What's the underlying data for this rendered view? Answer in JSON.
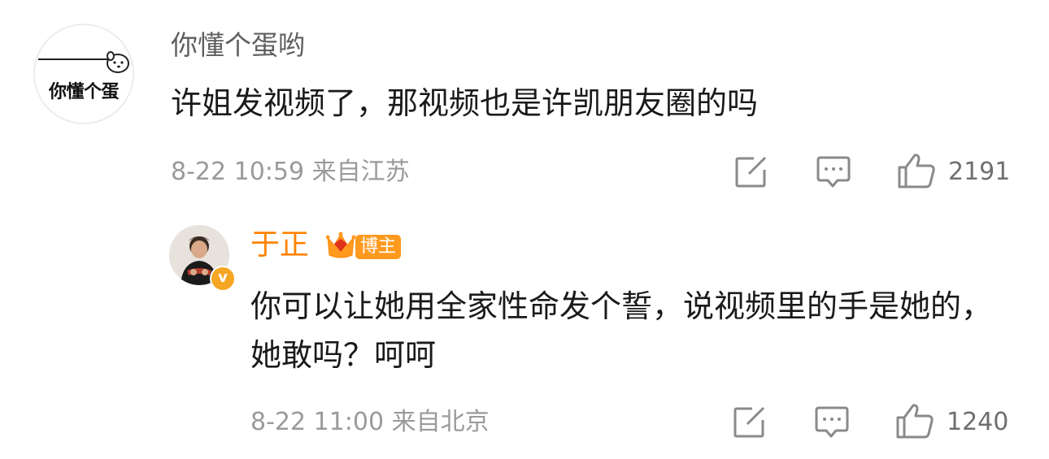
{
  "comment": {
    "avatar_text": "你懂个蛋",
    "username": "你懂个蛋哟",
    "text": "许姐发视频了，那视频也是许凯朋友圈的吗",
    "timestamp": "8-22 10:59",
    "location": "来自江苏",
    "likes": "2191",
    "icons": [
      "share-icon",
      "comment-icon",
      "like-icon"
    ]
  },
  "reply": {
    "username": "于正",
    "badge_label": "博主",
    "verified_mark": "v",
    "text": "你可以让她用全家性命发个誓，说视频里的手是她的，她敢吗？呵呵",
    "timestamp": "8-22 11:00",
    "location": "来自北京",
    "likes": "1240",
    "icons": [
      "share-icon",
      "comment-icon",
      "like-icon"
    ]
  },
  "colors": {
    "username_gray": "#5f5f5f",
    "meta_gray": "#9a9a9a",
    "reply_name_orange": "#ff8200",
    "badge_orange": "#ff9a1f",
    "text_dark": "#1a1a1a"
  }
}
